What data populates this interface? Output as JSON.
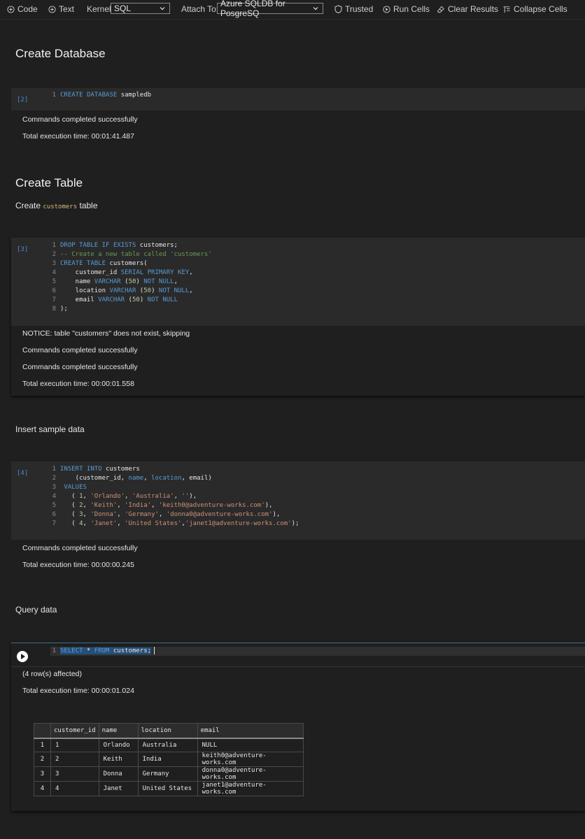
{
  "toolbar": {
    "code": "Code",
    "text": "Text",
    "kernel_label": "Kernel:",
    "kernel_value": "SQL",
    "attach_label": "Attach To:",
    "attach_value": "Azure SQLDB for PosgreSQ",
    "trusted": "Trusted",
    "run_cells": "Run Cells",
    "clear_results": "Clear Results",
    "collapse_cells": "Collapse Cells"
  },
  "sections": {
    "create_db_heading": "Create Database",
    "create_table_heading": "Create Table",
    "create_table_text_pre": "Create",
    "create_table_code": "customers",
    "create_table_text_post": "table",
    "insert_text": "Insert sample data",
    "query_text": "Query data"
  },
  "cell2": {
    "exec_count": "[2]",
    "lines": [
      "1",
      "CREATE",
      "DATABASE",
      "sampledb"
    ],
    "out1": "Commands completed successfully",
    "out2": "Total execution time: 00:01:41.487"
  },
  "cell3": {
    "exec_count": "[3]",
    "line_numbers": [
      "1",
      "2",
      "3",
      "4",
      "5",
      "6",
      "7",
      "8"
    ],
    "line1": {
      "kw": "DROP TABLE IF EXISTS",
      "tx": " customers;"
    },
    "line2": {
      "cm": "-- Create a new table called 'customers'"
    },
    "line3": {
      "kw": "CREATE TABLE",
      "tx": " customers("
    },
    "line4": {
      "tx": "    customer_id ",
      "kw": "SERIAL PRIMARY KEY",
      "tx2": ","
    },
    "line5": {
      "tx": "    name ",
      "kw": "VARCHAR",
      "tx2": " (",
      "num": "50",
      "tx3": ") ",
      "kw2": "NOT NULL",
      "tx4": ","
    },
    "line6": {
      "tx": "    location ",
      "kw": "VARCHAR",
      "tx2": " (",
      "num": "50",
      "tx3": ") ",
      "kw2": "NOT NULL",
      "tx4": ","
    },
    "line7": {
      "tx": "    email ",
      "kw": "VARCHAR",
      "tx2": " (",
      "num": "50",
      "tx3": ") ",
      "kw2": "NOT NULL"
    },
    "line8": {
      "tx": ");"
    },
    "out1": "NOTICE: table \"customers\" does not exist, skipping",
    "out2": "Commands completed successfully",
    "out3": "Commands completed successfully",
    "out4": "Total execution time: 00:00:01.558"
  },
  "cell4": {
    "exec_count": "[4]",
    "line_numbers": [
      "1",
      "2",
      "3",
      "4",
      "5",
      "6",
      "7"
    ],
    "line1": {
      "kw": "INSERT INTO",
      "tx": " customers"
    },
    "line2": {
      "tx": "    (customer_id, ",
      "kw": "name",
      "tx2": ", ",
      "kw2": "location",
      "tx3": ", email)"
    },
    "line3": {
      "tx": " ",
      "kw": "VALUES"
    },
    "line4": {
      "tx": "   ( ",
      "num": "1",
      "tx2": ", ",
      "s1": "'Orlando'",
      "tx3": ", ",
      "s2": "'Australia'",
      "tx4": ", ",
      "s3": "''",
      "tx5": "),"
    },
    "line5": {
      "tx": "   ( ",
      "num": "2",
      "tx2": ", ",
      "s1": "'Keith'",
      "tx3": ", ",
      "s2": "'India'",
      "tx4": ", ",
      "s3": "'keith0@adventure-works.com'",
      "tx5": "),"
    },
    "line6": {
      "tx": "   ( ",
      "num": "3",
      "tx2": ", ",
      "s1": "'Donna'",
      "tx3": ", ",
      "s2": "'Germany'",
      "tx4": ", ",
      "s3": "'donna0@adventure-works.com'",
      "tx5": "),"
    },
    "line7": {
      "tx": "   ( ",
      "num": "4",
      "tx2": ", ",
      "s1": "'Janet'",
      "tx3": ", ",
      "s2": "'United States'",
      "tx4": ",",
      "s3": "'janet1@adventure-works.com'",
      "tx5": ");"
    },
    "out1": "Commands completed successfully",
    "out2": "Total execution time: 00:00:00.245"
  },
  "cell5": {
    "line_number": "1",
    "kw1": "SELECT",
    "star": " * ",
    "kw2": "FROM",
    "tx": " customers;",
    "out1": "(4 row(s) affected)",
    "out2": "Total execution time: 00:00:01.024",
    "columns": [
      "",
      "customer_id",
      "name",
      "location",
      "email"
    ],
    "rows": [
      [
        "1",
        "1",
        "Orlando",
        "Australia",
        "NULL"
      ],
      [
        "2",
        "2",
        "Keith",
        "India",
        "keith0@adventure-works.com"
      ],
      [
        "3",
        "3",
        "Donna",
        "Germany",
        "donna0@adventure-works.com"
      ],
      [
        "4",
        "4",
        "Janet",
        "United States",
        "janet1@adventure-works.com"
      ]
    ]
  },
  "colors": {
    "background": "#1f1f1f",
    "code_background": "#2a2a2a",
    "keyword": "#569cd6",
    "string": "#ce9178",
    "comment": "#6a9955",
    "exec_count": "#4f88d8"
  }
}
